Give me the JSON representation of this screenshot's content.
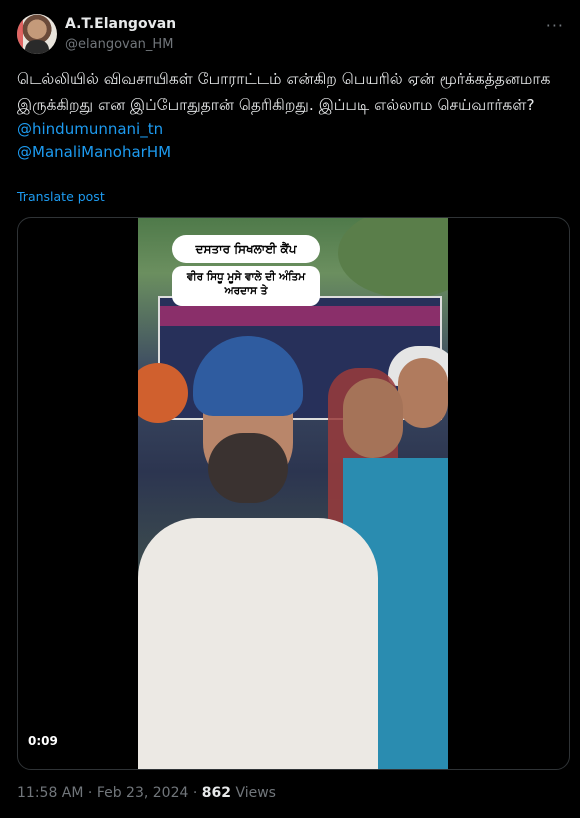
{
  "author": {
    "name": "A.T.Elangovan",
    "handle": "@elangovan_HM"
  },
  "more_icon": "more-horizontal-icon",
  "post": {
    "text": "டெல்லியில் விவசாயிகள் போராட்டம்  என்கிற பெயரில் ஏன் மூர்க்கத்தனமாக இருக்கிறது என இப்போதுதான் தெரிகிறது. இப்படி எல்லாம செய்வார்கள்?",
    "mentions": [
      "@hindumunnani_tn",
      "@ManaliManoharHM"
    ],
    "translate_label": "Translate post"
  },
  "video": {
    "caption_line1": "ਦਸਤਾਰ ਸਿਖਲਾਈ ਕੈਂਪ",
    "caption_line2": "ਵੀਰ ਸਿਧੂ ਮੂਸੇ ਵਾਲੇ ਦੀ ਅੰਤਿਮ ਅਰਦਾਸ ਤੇ",
    "time": "0:09"
  },
  "meta": {
    "time": "11:58 AM",
    "date": "Feb 23, 2024",
    "separator": "·",
    "views_count": "862",
    "views_label": "Views"
  }
}
